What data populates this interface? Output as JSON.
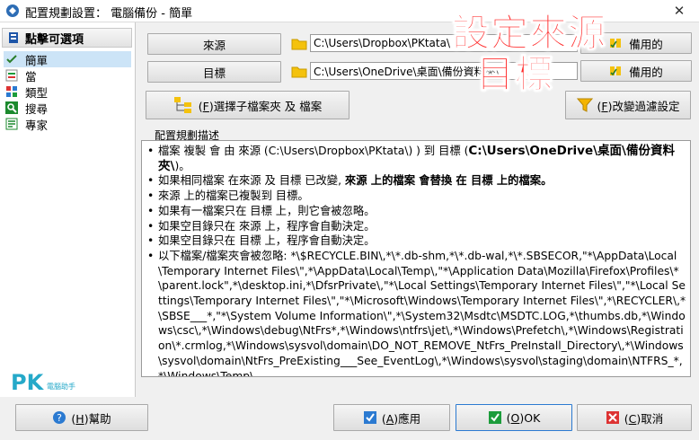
{
  "window": {
    "title": "配置規劃設置： 電腦備份 - 簡單",
    "close_glyph": "✕"
  },
  "sidebar": {
    "header": "點擊可選項",
    "items": [
      {
        "label": "簡單",
        "icon": "check-icon",
        "selected": true
      },
      {
        "label": "當",
        "icon": "equal-icon",
        "selected": false
      },
      {
        "label": "類型",
        "icon": "grid-icon",
        "selected": false
      },
      {
        "label": "搜尋",
        "icon": "search-icon",
        "selected": false
      },
      {
        "label": "專家",
        "icon": "expert-icon",
        "selected": false
      }
    ]
  },
  "source": {
    "button": "來源",
    "path": "C:\\Users\\Dropbox\\PKtata\\",
    "backup_label": "備用的"
  },
  "target": {
    "button": "目標",
    "path": "C:\\Users\\OneDrive\\桌面\\備份資料夾\\",
    "backup_label": "備用的"
  },
  "select_subfolder": {
    "key": "F",
    "label": "選擇子檔案夾 及 檔案"
  },
  "filter": {
    "key": "F",
    "label": "改變過濾設定"
  },
  "description": {
    "label": "配置規劃描述",
    "lines": [
      {
        "pre": "檔案 複製 會 由 來源 (C:\\Users\\Dropbox\\PKtata\\)         ) 到 目標 (",
        "bold": "C:\\Users\\OneDrive\\桌面\\備份資料夾\\",
        "post": ")。"
      },
      {
        "pre": "如果相同檔案 在來源 及 目標 已改變, ",
        "bold": "來源 上的檔案 會替換 在 目標 上的檔案。",
        "post": ""
      },
      {
        "pre": "來源 上的檔案已複製到 目標。",
        "bold": "",
        "post": ""
      },
      {
        "pre": "如果有一檔案只在 目標 上，則它會被忽略。",
        "bold": "",
        "post": ""
      },
      {
        "pre": "如果空目錄只在 來源 上，程序會自動決定。",
        "bold": "",
        "post": ""
      },
      {
        "pre": "如果空目錄只在 目標 上，程序會自動決定。",
        "bold": "",
        "post": ""
      },
      {
        "pre": "以下檔案/檔案夾會被忽略:  *\\$RECYCLE.BIN\\,*\\*.db-shm,*\\*.db-wal,*\\*.SBSECOR,\"*\\AppData\\Local\\Temporary Internet Files\\\",*\\AppData\\Local\\Temp\\,\"*\\Application Data\\Mozilla\\Firefox\\Profiles\\*\\parent.lock\",*\\desktop.ini,*\\DfsrPrivate\\,\"*\\Local Settings\\Temporary Internet Files\\\",\"*\\Local Settings\\Temporary Internet Files\\\",\"*\\Microsoft\\Windows\\Temporary Internet Files\\\",*\\RECYCLER\\,*\\SBSE___*,\"*\\System Volume Information\\\",*\\System32\\Msdtc\\MSDTC.LOG,*\\thumbs.db,*\\Windows\\csc\\,*\\Windows\\debug\\NtFrs*,*\\Windows\\ntfrs\\jet\\,*\\Windows\\Prefetch\\,*\\Windows\\Registration\\*.crmlog,*\\Windows\\sysvol\\domain\\DO_NOT_REMOVE_NtFrs_PreInstall_Directory\\,*\\Windows\\sysvol\\domain\\NtFrs_PreExisting___See_EventLog\\,*\\Windows\\sysvol\\staging\\domain\\NTFRS_*,*\\Windows\\Temp\\,",
        "bold": "",
        "post": ""
      }
    ]
  },
  "overlay": {
    "line1": "設定來源",
    "line2": "目標",
    "color": "#ff2a2a"
  },
  "watermark": {
    "text": "PK",
    "sub": "電腦助手"
  },
  "footer": {
    "help": {
      "key": "H",
      "label": "幫助"
    },
    "apply": {
      "key": "A",
      "label": "應用"
    },
    "ok": {
      "key": "O",
      "label": "OK"
    },
    "cancel": {
      "key": "C",
      "label": "取消"
    }
  }
}
